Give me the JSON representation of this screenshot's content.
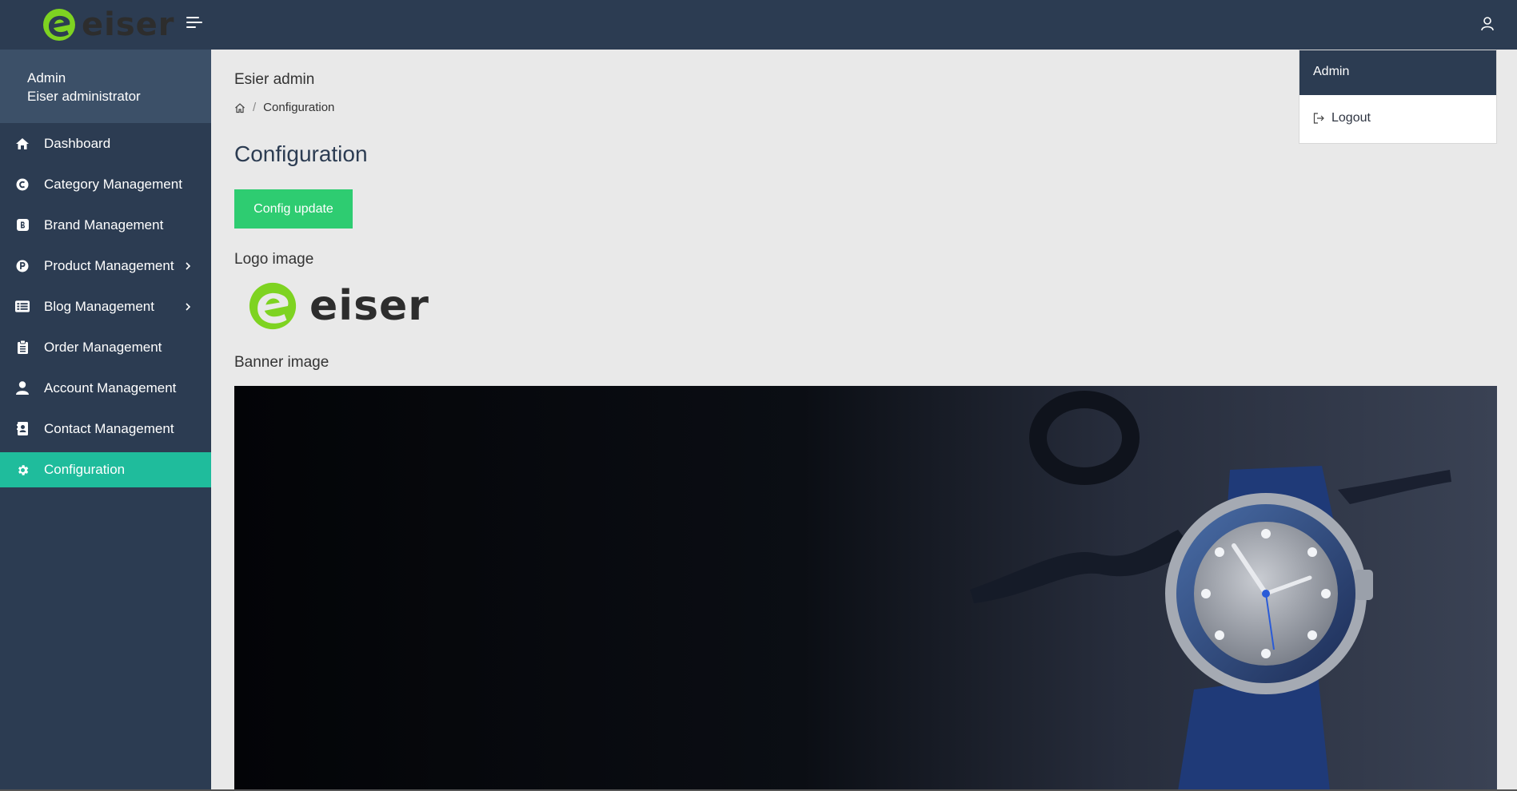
{
  "header": {
    "brand": "eiser",
    "menu_toggle_icon": "hamburger-icon",
    "user_icon": "user-icon"
  },
  "sidebar": {
    "profile": {
      "name": "Admin",
      "role": "Eiser administrator"
    },
    "items": [
      {
        "label": "Dashboard",
        "icon": "home-icon",
        "has_submenu": false,
        "active": false
      },
      {
        "label": "Category Management",
        "icon": "category-icon",
        "has_submenu": false,
        "active": false
      },
      {
        "label": "Brand Management",
        "icon": "brand-icon",
        "has_submenu": false,
        "active": false
      },
      {
        "label": "Product Management",
        "icon": "product-icon",
        "has_submenu": true,
        "active": false
      },
      {
        "label": "Blog Management",
        "icon": "blog-icon",
        "has_submenu": true,
        "active": false
      },
      {
        "label": "Order Management",
        "icon": "clipboard-icon",
        "has_submenu": false,
        "active": false
      },
      {
        "label": "Account Management",
        "icon": "user-icon",
        "has_submenu": false,
        "active": false
      },
      {
        "label": "Contact Management",
        "icon": "contact-icon",
        "has_submenu": false,
        "active": false
      },
      {
        "label": "Configuration",
        "icon": "gear-icon",
        "has_submenu": false,
        "active": true
      }
    ]
  },
  "main": {
    "site_title": "Esier admin",
    "breadcrumb": {
      "home_icon": "home-icon",
      "current": "Configuration"
    },
    "page_title": "Configuration",
    "update_button": "Config update",
    "logo_label": "Logo image",
    "logo_text": "eiser",
    "banner_label": "Banner image"
  },
  "dropdown": {
    "header": "Admin",
    "logout_label": "Logout",
    "logout_icon": "logout-icon"
  },
  "colors": {
    "topbar": "#2c3c52",
    "sidebar": "#2c3c52",
    "profile_bg": "#3c5068",
    "active_item": "#1fbc9c",
    "primary_button": "#2ecc71",
    "content_bg": "#e9e9e9",
    "logo_green": "#7ed321"
  }
}
